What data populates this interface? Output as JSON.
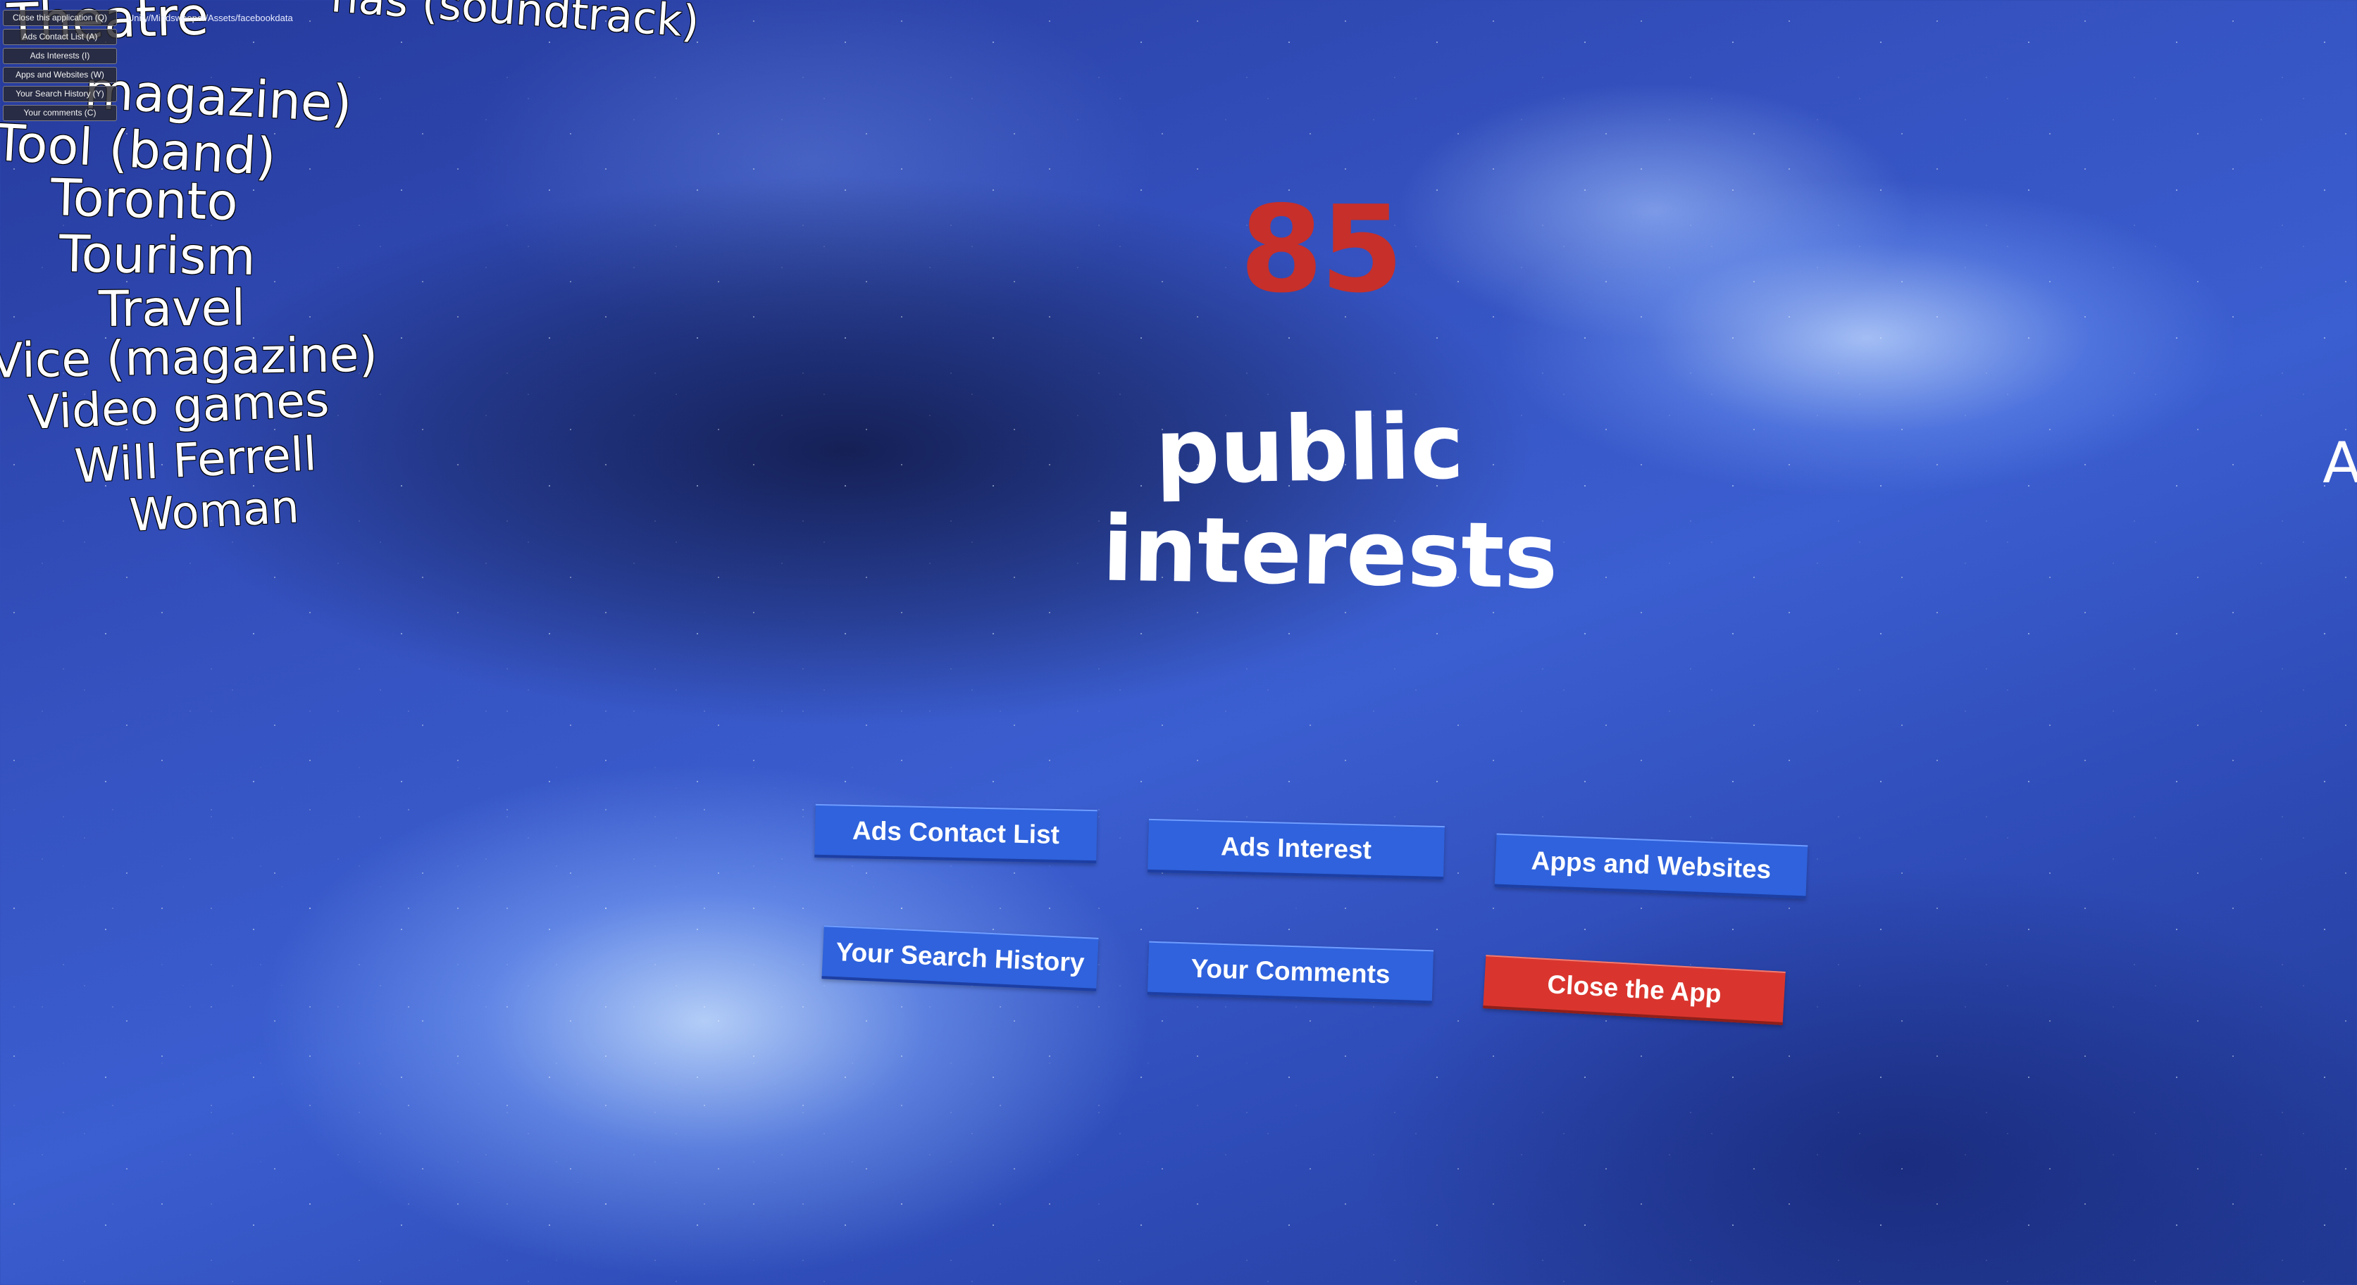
{
  "debug": {
    "path_text": "...Unity/Mindsweeper/Assets/facebookdata",
    "menu": [
      "Close this application (Q)",
      "Ads Contact List (A)",
      "Ads Interests (I)",
      "Apps and Websites (W)",
      "Your Search History (Y)",
      "Your comments (C)"
    ]
  },
  "interests": [
    "nas (soundtrack)",
    "Theatre",
    "magazine)",
    "Tool (band)",
    "Toronto",
    "Tourism",
    "Travel",
    "Vice (magazine)",
    "Video games",
    "Will Ferrell",
    "Woman"
  ],
  "counter": {
    "value": "85",
    "label_line1": "public",
    "label_line2": "interests"
  },
  "edge_glyph": "A",
  "buttons": {
    "ads_contact_list": "Ads Contact List",
    "ads_interest": "Ads Interest",
    "apps_and_websites": "Apps and Websites",
    "your_search_history": "Your Search History",
    "your_comments": "Your Comments",
    "close_app": "Close the App"
  },
  "colors": {
    "counter_red": "#c62f2a",
    "button_blue": "#2f62dc",
    "button_red": "#d9352e"
  }
}
